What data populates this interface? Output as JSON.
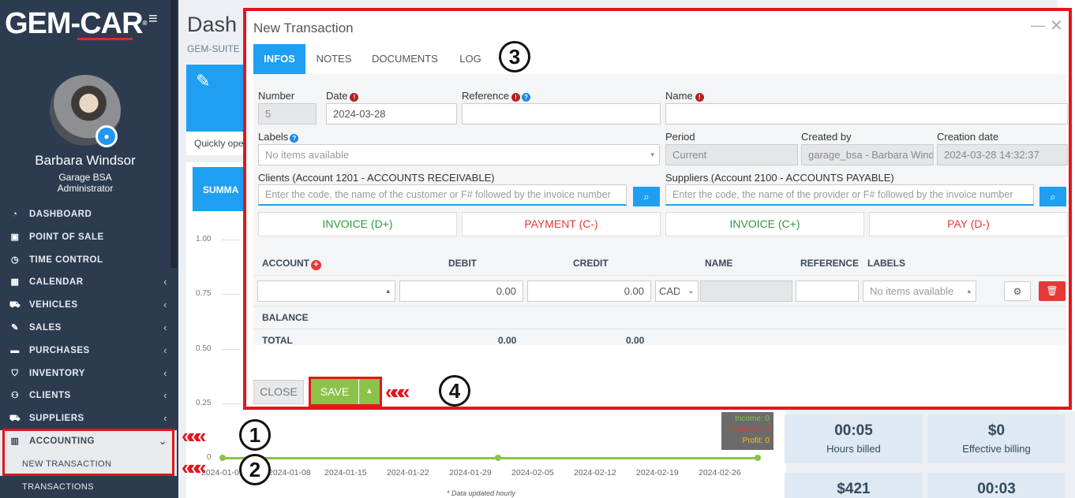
{
  "sidebar": {
    "logo": "GEM-CAR",
    "logo_mark": "®",
    "user": {
      "name": "Barbara Windsor",
      "garage": "Garage BSA",
      "role": "Administrator"
    },
    "items": [
      {
        "label": "DASHBOARD",
        "icon": "dashboard-icon",
        "glyph": "◔"
      },
      {
        "label": "POINT OF SALE",
        "icon": "point-of-sale-icon",
        "glyph": "▣"
      },
      {
        "label": "TIME CONTROL",
        "icon": "clock-icon",
        "glyph": "◷"
      },
      {
        "label": "CALENDAR",
        "icon": "calendar-icon",
        "glyph": "▦"
      },
      {
        "label": "VEHICLES",
        "icon": "car-icon",
        "glyph": "⛟"
      },
      {
        "label": "SALES",
        "icon": "edit-icon",
        "glyph": "✎"
      },
      {
        "label": "PURCHASES",
        "icon": "card-icon",
        "glyph": "▬"
      },
      {
        "label": "INVENTORY",
        "icon": "cart-icon",
        "glyph": "⛉"
      },
      {
        "label": "CLIENTS",
        "icon": "users-icon",
        "glyph": "⚇"
      },
      {
        "label": "SUPPLIERS",
        "icon": "truck-icon",
        "glyph": "⛟"
      },
      {
        "label": "ACCOUNTING",
        "icon": "bar-chart-icon",
        "glyph": "▥"
      }
    ],
    "subitems": [
      "NEW TRANSACTION",
      "TRANSACTIONS"
    ]
  },
  "dashboard": {
    "title": "Dash",
    "subtitle": "GEM-SUITE",
    "quick_text": "Quickly ope",
    "summary_tab": "SUMMA",
    "yticks": [
      "1.00",
      "0.75",
      "0.50",
      "0.25",
      "0"
    ],
    "xticks": [
      "2024-01-01",
      "2024-01-08",
      "2024-01-15",
      "2024-01-22",
      "2024-01-29",
      "2024-02-05",
      "2024-02-12",
      "2024-02-19",
      "2024-02-26"
    ],
    "note": "* Data updated hourly",
    "legend": {
      "income": "Income: 0",
      "expense": "Expense: 0",
      "profit": "Profit: 0"
    },
    "legend_colors": {
      "income": "#8bc34a",
      "expense": "#e53935",
      "profit": "#ffc107"
    },
    "stats": [
      {
        "value": "00:05",
        "label": "Hours billed"
      },
      {
        "value": "$0",
        "label": "Effective billing"
      },
      {
        "value": "$421",
        "label": ""
      },
      {
        "value": "00:03",
        "label": ""
      }
    ]
  },
  "chart_data": {
    "type": "line",
    "x": [
      "2024-01-01",
      "2024-01-08",
      "2024-01-15",
      "2024-01-22",
      "2024-01-29",
      "2024-02-05",
      "2024-02-12",
      "2024-02-19",
      "2024-02-26"
    ],
    "series": [
      {
        "name": "Income",
        "values": [
          0,
          0,
          0,
          0,
          0,
          0,
          0,
          0,
          0
        ]
      }
    ],
    "ylim": [
      0,
      1.0
    ]
  },
  "modal": {
    "title": "New Transaction",
    "tabs": [
      "INFOS",
      "NOTES",
      "DOCUMENTS",
      "LOG"
    ],
    "fields": {
      "number_label": "Number",
      "number_value": "5",
      "date_label": "Date",
      "date_value": "2024-03-28",
      "reference_label": "Reference",
      "reference_value": "",
      "name_label": "Name",
      "name_value": "",
      "labels_label": "Labels",
      "labels_value": "No items available",
      "period_label": "Period",
      "period_value": "Current",
      "created_by_label": "Created by",
      "created_by_value": "garage_bsa - Barbara Windsor",
      "creation_date_label": "Creation date",
      "creation_date_value": "2024-03-28 14:32:37",
      "clients_label": "Clients (Account 1201 - ACCOUNTS RECEIVABLE)",
      "clients_placeholder": "Enter the code, the name of the customer or F# followed by the invoice number",
      "suppliers_label": "Suppliers (Account 2100 - ACCOUNTS PAYABLE)",
      "suppliers_placeholder": "Enter the code, the name of the provider or F# followed by the invoice number"
    },
    "actions": [
      "INVOICE (D+)",
      "PAYMENT (C-)",
      "INVOICE (C+)",
      "PAY (D-)"
    ],
    "table": {
      "headers": [
        "ACCOUNT",
        "DEBIT",
        "CREDIT",
        "NAME",
        "REFERENCE",
        "LABELS"
      ],
      "row": {
        "debit": "0.00",
        "credit": "0.00",
        "currency": "CAD",
        "labels": "No items available"
      },
      "balance_label": "BALANCE",
      "total_label": "TOTAL",
      "total_debit": "0.00",
      "total_credit": "0.00"
    },
    "footer": {
      "close": "CLOSE",
      "save": "SAVE"
    }
  },
  "annotations": [
    "1",
    "2",
    "3",
    "4"
  ]
}
